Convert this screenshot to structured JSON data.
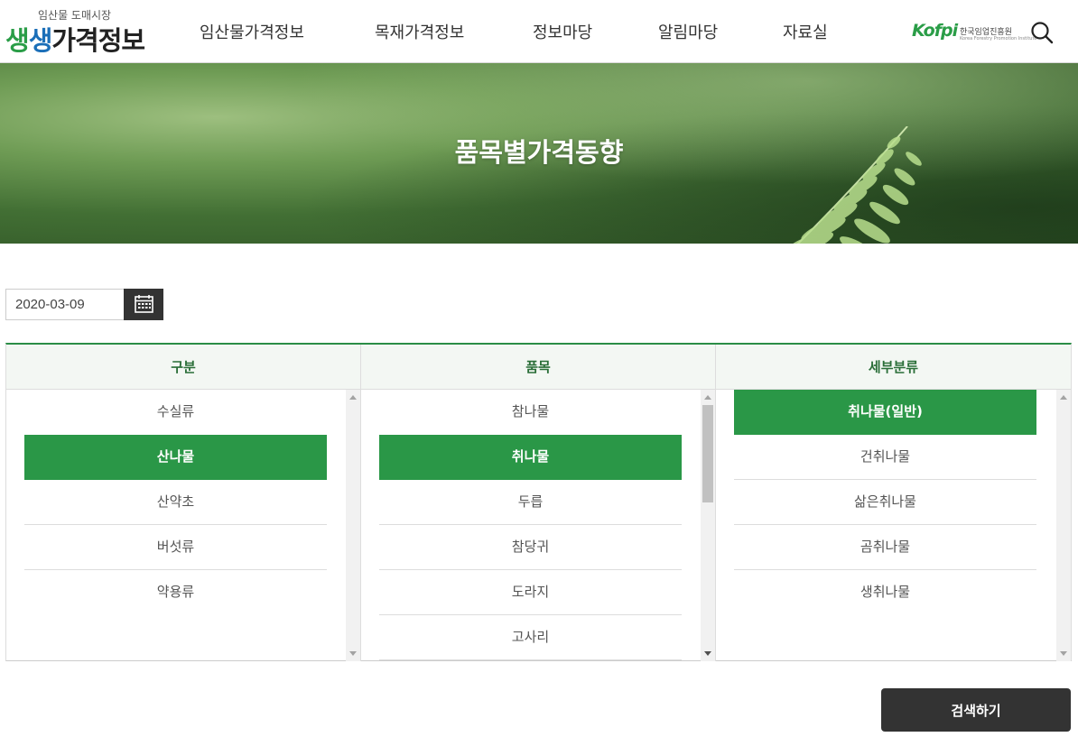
{
  "header": {
    "logo_sub": "임산물 도매시장",
    "logo_main_1": "생",
    "logo_main_2": "생",
    "logo_main_3": "가격정보",
    "nav": [
      "임산물가격정보",
      "목재가격정보",
      "정보마당",
      "알림마당",
      "자료실"
    ],
    "partner_logo_mark": "Kofpi",
    "partner_logo_text": "한국임업진흥원",
    "partner_logo_en": "Korea Forestry Promotion Institute",
    "search_icon": "search-icon"
  },
  "banner": {
    "title": "품목별가격동향"
  },
  "date_filter": {
    "value": "2020-03-09",
    "calendar_icon": "calendar-icon"
  },
  "selector": {
    "columns": [
      {
        "header": "구분",
        "items": [
          "수실류",
          "산나물",
          "산약초",
          "버섯류",
          "약용류"
        ],
        "selected": "산나물"
      },
      {
        "header": "품목",
        "items": [
          "참나물",
          "취나물",
          "두릅",
          "참당귀",
          "도라지",
          "고사리"
        ],
        "selected": "취나물"
      },
      {
        "header": "세부분류",
        "items": [
          "취나물(일반)",
          "건취나물",
          "삶은취나물",
          "곰취나물",
          "생취나물"
        ],
        "selected": "취나물(일반)"
      }
    ]
  },
  "actions": {
    "search_label": "검색하기"
  },
  "colors": {
    "accent_green": "#2a9747",
    "header_text_green": "#2a6e38",
    "button_dark": "#333333"
  }
}
